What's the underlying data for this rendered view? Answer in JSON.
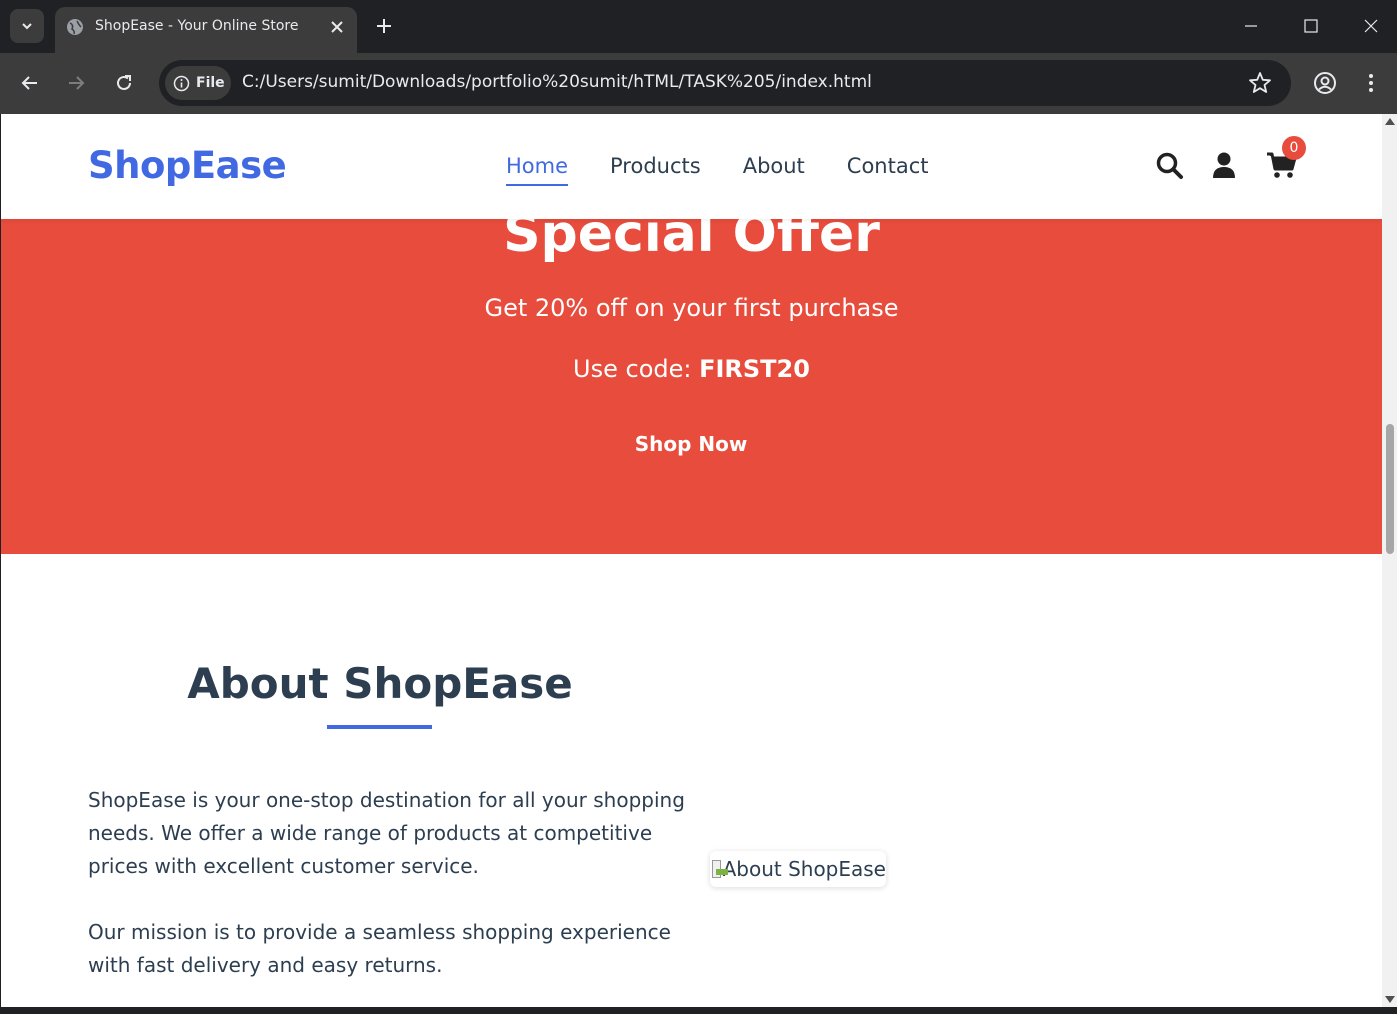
{
  "browser": {
    "tab_title": "ShopEase - Your Online Store",
    "url": "C:/Users/sumit/Downloads/portfolio%20sumit/hTML/TASK%205/index.html",
    "file_chip": "File"
  },
  "site": {
    "logo": "ShopEase",
    "nav": [
      "Home",
      "Products",
      "About",
      "Contact"
    ],
    "cart_count": "0",
    "colors": {
      "primary": "#4169e1",
      "accent": "#e74c3c",
      "text": "#2c3e50"
    }
  },
  "hero": {
    "title": "Special Offer",
    "subtitle": "Get 20% off on your first purchase",
    "code_label": "Use code: ",
    "code": "FIRST20",
    "button": "Shop Now"
  },
  "about": {
    "title": "About ShopEase",
    "paragraph1": "ShopEase is your one-stop destination for all your shopping needs. We offer a wide range of products at competitive prices with excellent customer service.",
    "paragraph2": "Our mission is to provide a seamless shopping experience with fast delivery and easy returns.",
    "image_alt": "About ShopEase"
  }
}
